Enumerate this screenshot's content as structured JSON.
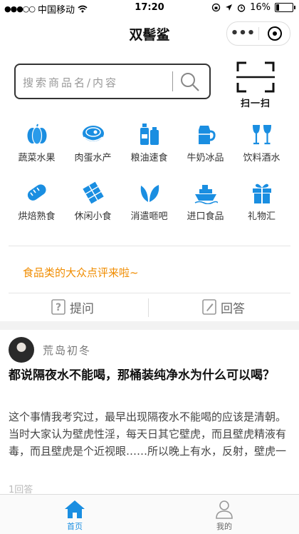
{
  "status_bar": {
    "carrier": "中国移动",
    "time": "17:20",
    "battery": "16%",
    "signal_dots": "●●●○○"
  },
  "nav": {
    "title": "双髻鲨",
    "more": "•••"
  },
  "search": {
    "placeholder": "搜索商品名/内容"
  },
  "scan": {
    "label": "扫一扫"
  },
  "categories": [
    {
      "label": "蔬菜水果",
      "icon": "pumpkin-icon"
    },
    {
      "label": "肉蛋水产",
      "icon": "meat-icon"
    },
    {
      "label": "粮油速食",
      "icon": "oil-bottle-icon"
    },
    {
      "label": "牛奶冰品",
      "icon": "milk-jug-icon"
    },
    {
      "label": "饮料酒水",
      "icon": "wine-glass-icon"
    },
    {
      "label": "烘焙熟食",
      "icon": "bread-icon"
    },
    {
      "label": "休闲小食",
      "icon": "chocolate-icon"
    },
    {
      "label": "消遣咂吧",
      "icon": "leaf-icon"
    },
    {
      "label": "进口食品",
      "icon": "ship-icon"
    },
    {
      "label": "礼物汇",
      "icon": "gift-icon"
    }
  ],
  "promo": {
    "text": "食品类的大众点评来啦~"
  },
  "actions": {
    "ask": "提问",
    "answer": "回答"
  },
  "post": {
    "author": "荒岛初冬",
    "title": "都说隔夜水不能喝，那桶装纯净水为什么可以喝？",
    "excerpt": "这个事情我考究过，最早出现隔夜水不能喝的应该是清朝。当时大家认为壁虎性淫，每天日其它壁虎，而且壁虎精液有毒，而且壁虎是个近视眼……所以晚上有水，反射，壁虎一看，呦！这…",
    "answers": "1回答"
  },
  "tabs": {
    "home": "首页",
    "mine": "我的"
  },
  "colors": {
    "accent": "#1a8ee1",
    "promo": "#f08c00"
  }
}
